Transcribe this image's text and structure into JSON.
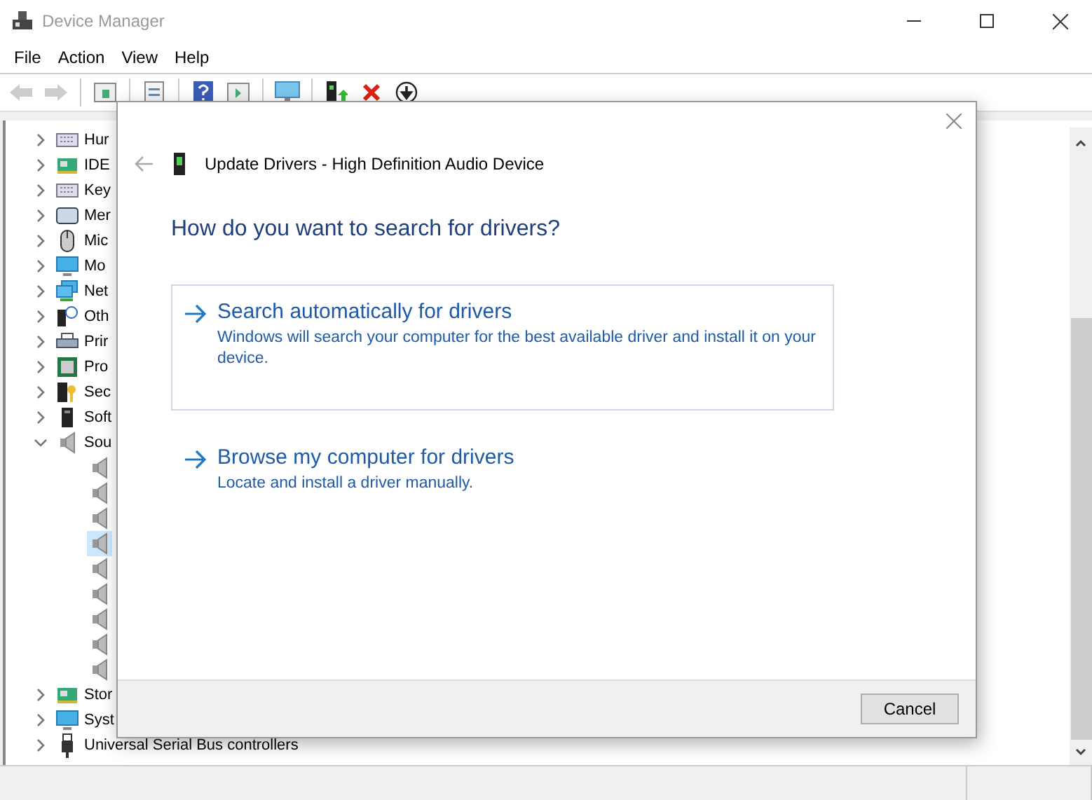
{
  "window": {
    "title": "Device Manager"
  },
  "menu": [
    "File",
    "Action",
    "View",
    "Help"
  ],
  "toolbar": [
    {
      "kind": "back",
      "disabled": true
    },
    {
      "kind": "forward",
      "disabled": true
    },
    {
      "kind": "separator",
      "disabled": false
    },
    {
      "kind": "properties",
      "disabled": false
    },
    {
      "kind": "separator",
      "disabled": false
    },
    {
      "kind": "list",
      "disabled": false
    },
    {
      "kind": "separator",
      "disabled": false
    },
    {
      "kind": "help",
      "disabled": false
    },
    {
      "kind": "play",
      "disabled": false
    },
    {
      "kind": "separator",
      "disabled": false
    },
    {
      "kind": "monitor",
      "disabled": false
    },
    {
      "kind": "separator",
      "disabled": false
    },
    {
      "kind": "update",
      "disabled": false
    },
    {
      "kind": "remove",
      "disabled": false
    },
    {
      "kind": "download",
      "disabled": false
    }
  ],
  "tree": [
    {
      "label": "Hur",
      "expanded": false
    },
    {
      "label": "IDE",
      "expanded": false
    },
    {
      "label": "Key",
      "expanded": false
    },
    {
      "label": "Mer",
      "expanded": false
    },
    {
      "label": "Mic",
      "expanded": false
    },
    {
      "label": "Mo",
      "expanded": false
    },
    {
      "label": "Net",
      "expanded": false
    },
    {
      "label": "Oth",
      "expanded": false
    },
    {
      "label": "Prir",
      "expanded": false
    },
    {
      "label": "Pro",
      "expanded": false
    },
    {
      "label": "Sec",
      "expanded": false
    },
    {
      "label": "Soft",
      "expanded": false
    },
    {
      "label": "Sou",
      "expanded": true,
      "children": [
        {
          "selected": false
        },
        {
          "selected": false
        },
        {
          "selected": false
        },
        {
          "selected": true
        },
        {
          "selected": false
        },
        {
          "selected": false
        },
        {
          "selected": false
        },
        {
          "selected": false
        },
        {
          "selected": false
        }
      ]
    },
    {
      "label": "Stor",
      "expanded": false
    },
    {
      "label": "Syst",
      "expanded": false
    },
    {
      "label": "Universal Serial Bus controllers",
      "expanded": false
    }
  ],
  "dialog": {
    "title": "Update Drivers - High Definition Audio Device",
    "heading": "How do you want to search for drivers?",
    "options": [
      {
        "title": "Search automatically for drivers",
        "description": "Windows will search your computer for the best available driver and install it on your device.",
        "selected": true
      },
      {
        "title": "Browse my computer for drivers",
        "description": "Locate and install a driver manually.",
        "selected": false
      }
    ],
    "buttons": [
      "Cancel"
    ]
  }
}
